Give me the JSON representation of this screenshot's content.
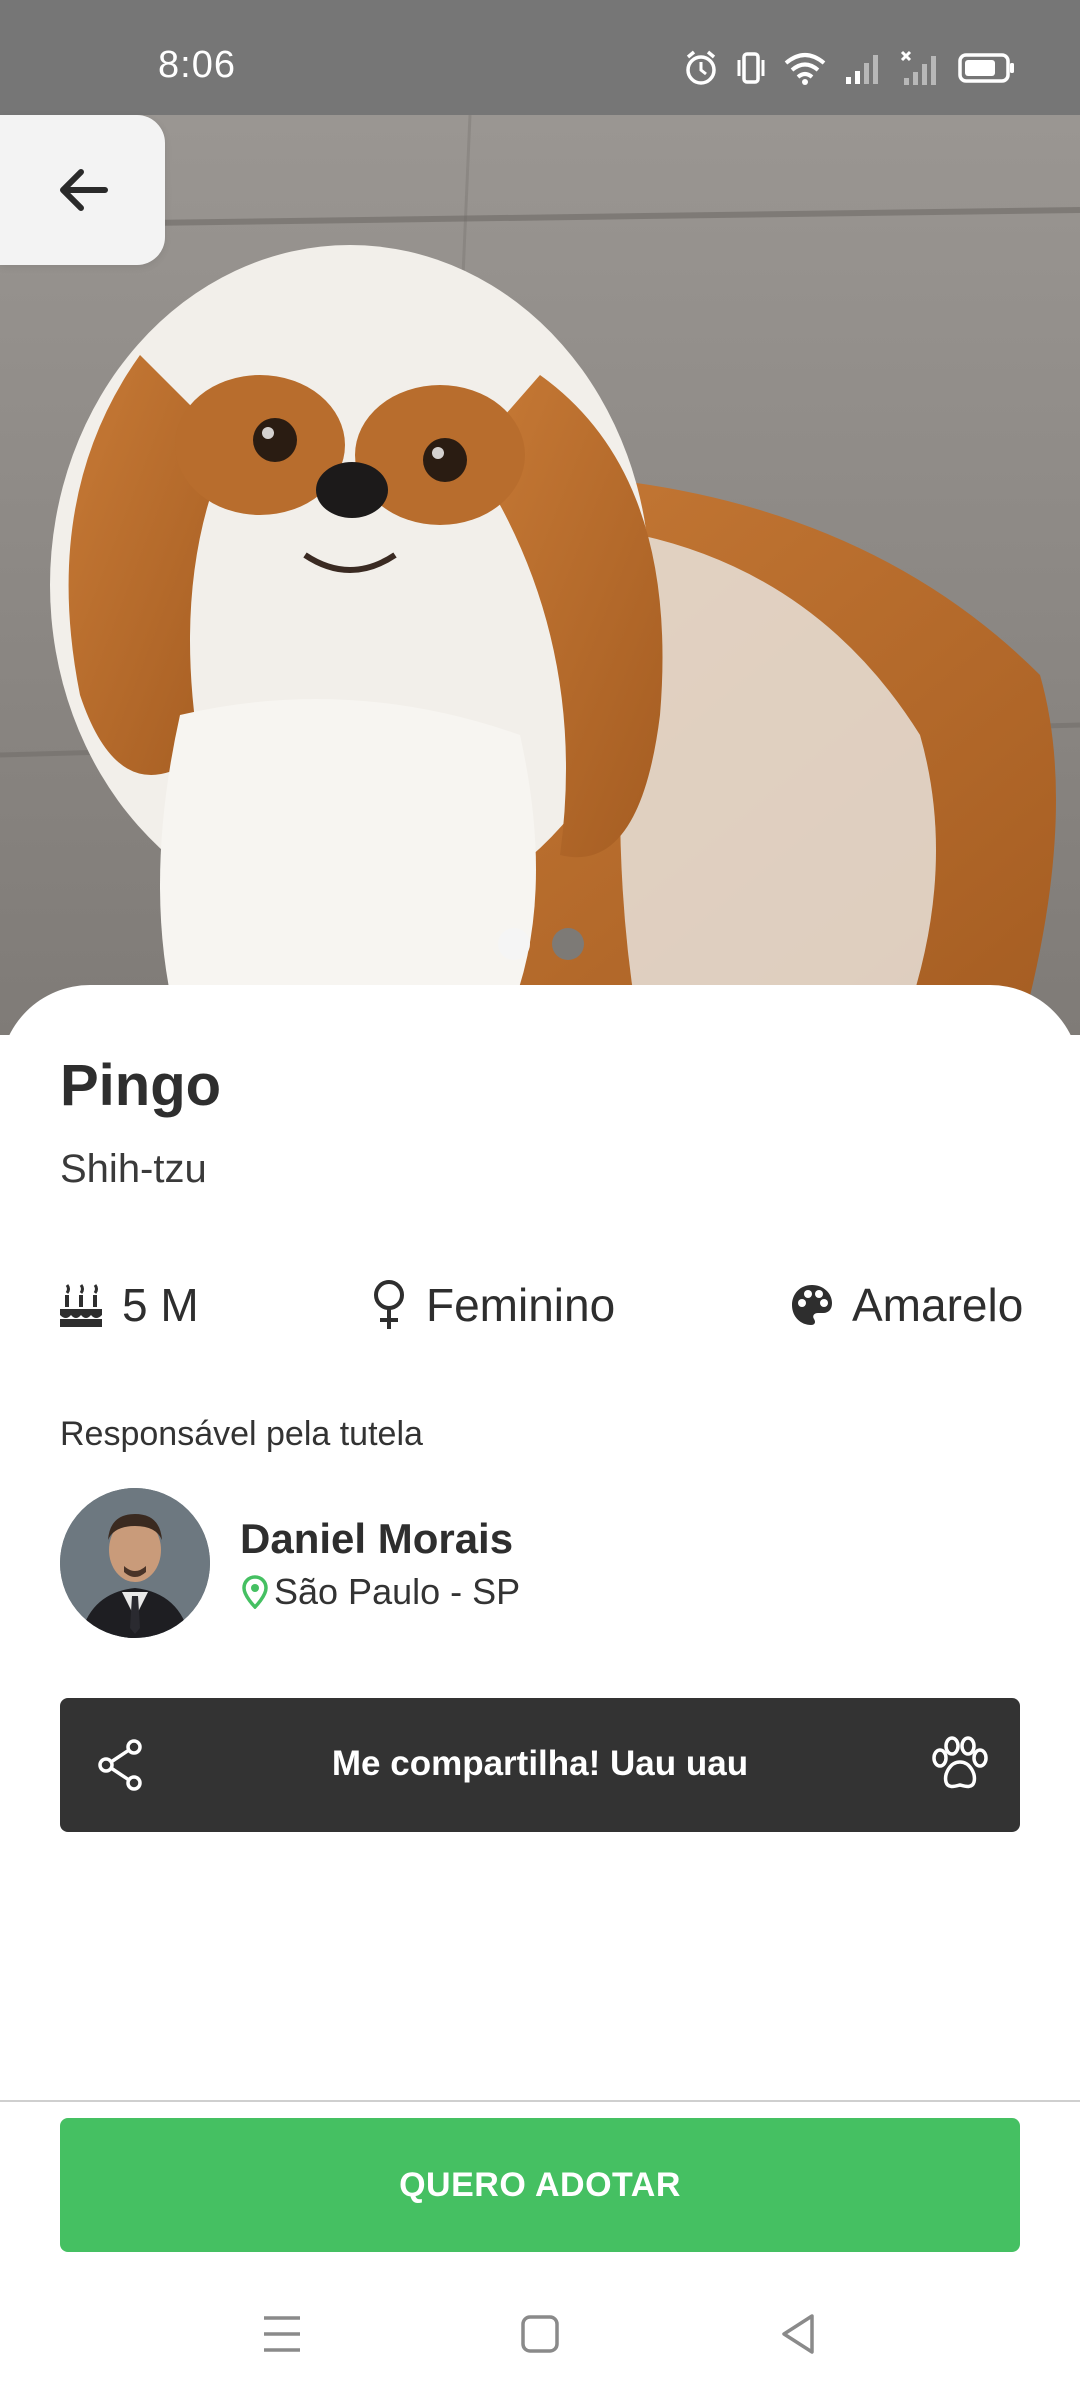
{
  "status_bar": {
    "time": "8:06",
    "icons": [
      "alarm-icon",
      "vibrate-icon",
      "wifi-icon",
      "signal-icon",
      "signal-no-service-icon",
      "battery-icon"
    ]
  },
  "hero": {
    "image": "shih-tzu dog photo",
    "page_dots": 2,
    "active_dot": 1
  },
  "pet": {
    "name": "Pingo",
    "breed": "Shih-tzu",
    "age": "5 M",
    "sex": "Feminino",
    "color": "Amarelo"
  },
  "guardian": {
    "label": "Responsável pela tutela",
    "name": "Daniel Morais",
    "location": "São Paulo - SP"
  },
  "share": {
    "label": "Me compartilha! Uau uau"
  },
  "adopt": {
    "label": "QUERO ADOTAR"
  },
  "colors": {
    "accent_green": "#45c062",
    "dark_bar": "#333333",
    "status_bar": "#767676"
  }
}
